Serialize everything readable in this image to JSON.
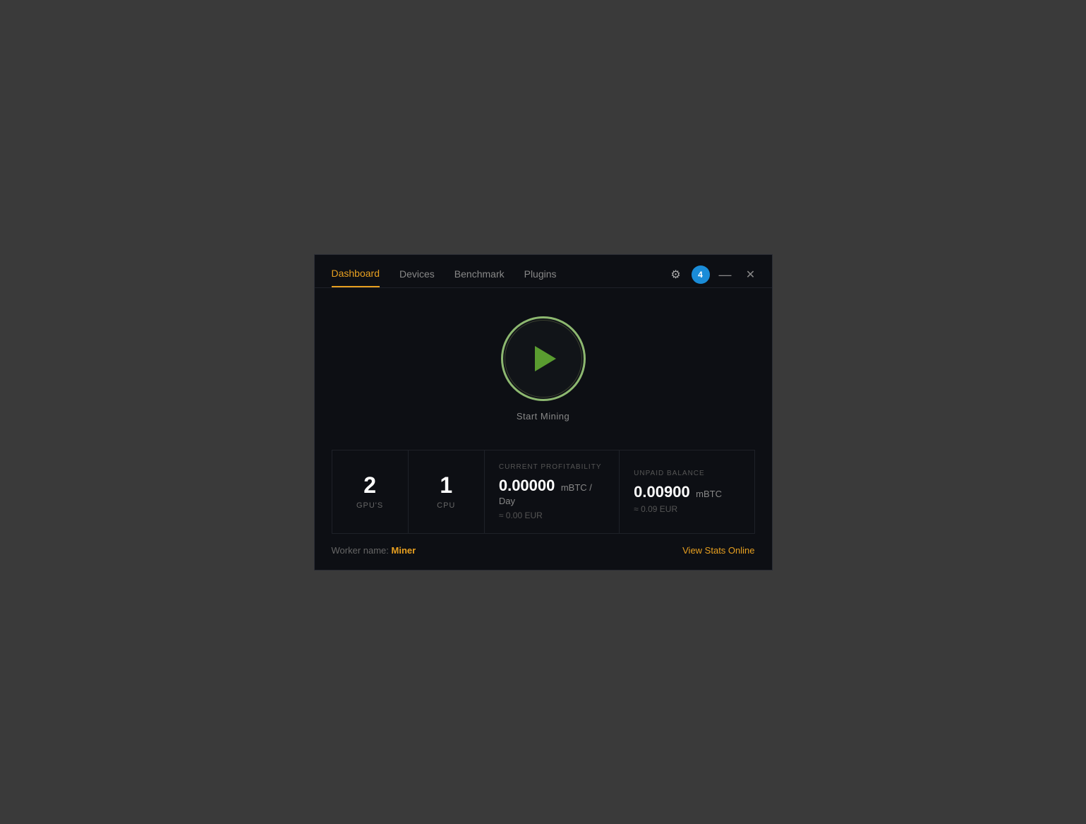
{
  "nav": {
    "items": [
      {
        "label": "Dashboard",
        "active": true
      },
      {
        "label": "Devices",
        "active": false
      },
      {
        "label": "Benchmark",
        "active": false
      },
      {
        "label": "Plugins",
        "active": false
      }
    ]
  },
  "window_controls": {
    "notification_count": "4",
    "minimize_symbol": "—",
    "close_symbol": "✕"
  },
  "mining": {
    "start_label": "Start Mining"
  },
  "stats": {
    "gpus_count": "2",
    "gpus_label": "GPU'S",
    "cpu_count": "1",
    "cpu_label": "CPU",
    "profitability": {
      "title": "CURRENT PROFITABILITY",
      "value": "0.00000",
      "unit": "mBTC / Day",
      "eur": "≈ 0.00 EUR"
    },
    "balance": {
      "title": "UNPAID BALANCE",
      "value": "0.00900",
      "unit": "mBTC",
      "eur": "≈ 0.09 EUR"
    }
  },
  "footer": {
    "worker_label": "Worker name:",
    "worker_name": "Miner",
    "view_stats": "View Stats Online"
  }
}
